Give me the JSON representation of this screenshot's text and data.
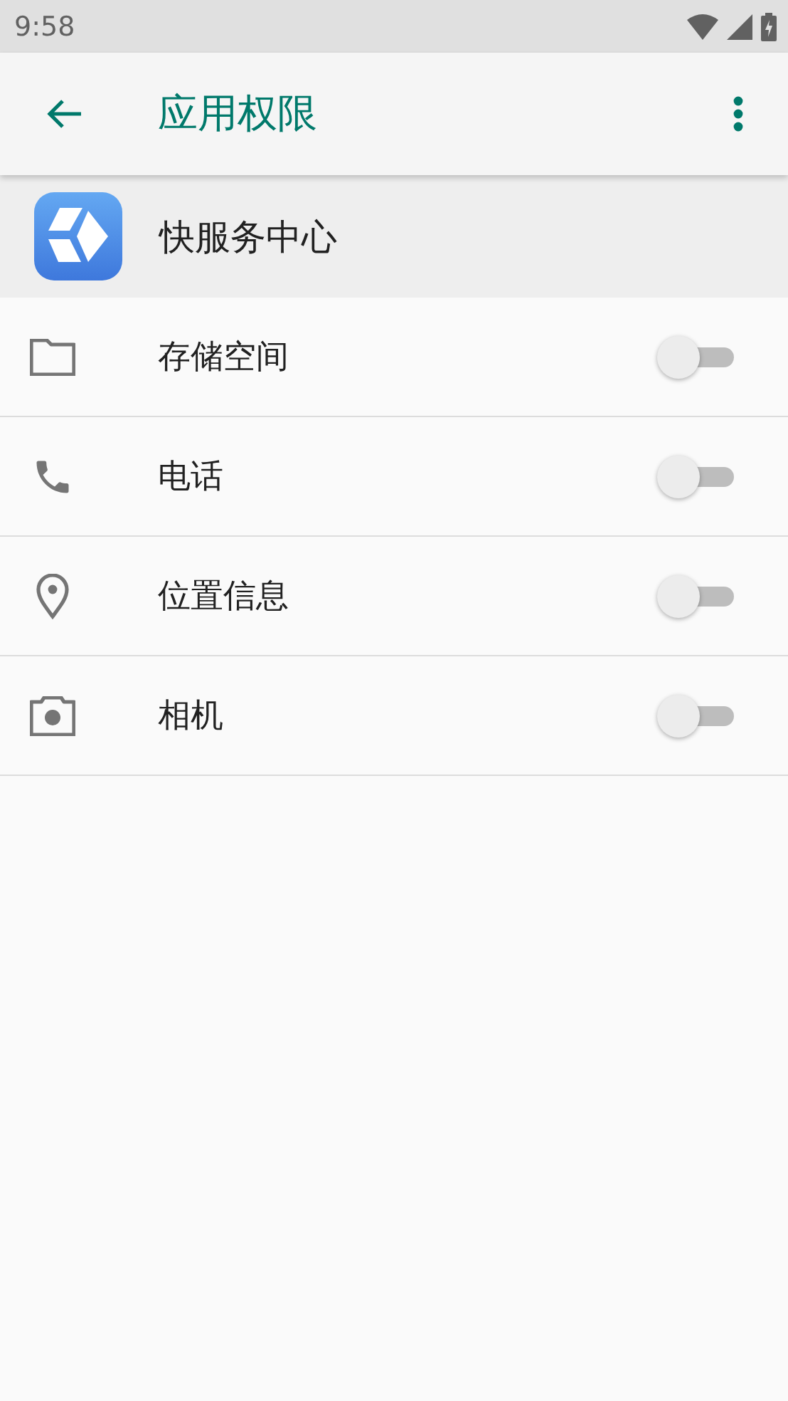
{
  "status_bar": {
    "time": "9:58"
  },
  "toolbar": {
    "title": "应用权限"
  },
  "app": {
    "name": "快服务中心"
  },
  "permissions": [
    {
      "label": "存储空间",
      "on": false
    },
    {
      "label": "电话",
      "on": false
    },
    {
      "label": "位置信息",
      "on": false
    },
    {
      "label": "相机",
      "on": false
    }
  ]
}
